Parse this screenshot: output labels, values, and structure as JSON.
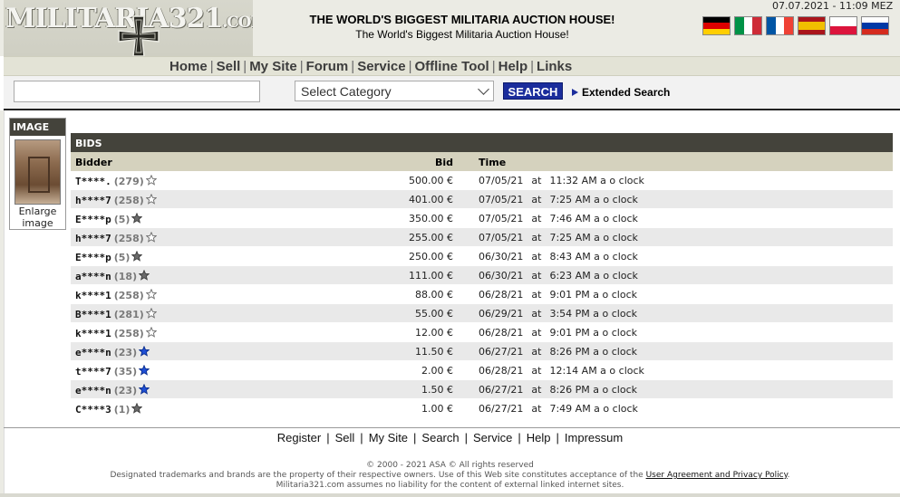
{
  "header": {
    "logo_main": "MILITARIA",
    "logo_num": "321",
    "logo_com": ".COM",
    "tagline_bold": "THE WORLD'S BIGGEST MILITARIA AUCTION HOUSE!",
    "tagline": "The World's Biggest Militaria Auction House!",
    "datetime": "07.07.2021 - 11:09 MEZ"
  },
  "flags": [
    {
      "name": "germany-flag",
      "dir": "h",
      "colors": [
        "#000000",
        "#dd0000",
        "#ffce00"
      ]
    },
    {
      "name": "italy-flag",
      "dir": "v",
      "colors": [
        "#009246",
        "#ffffff",
        "#ce2b37"
      ]
    },
    {
      "name": "france-flag",
      "dir": "v",
      "colors": [
        "#0055a4",
        "#ffffff",
        "#ef4135"
      ]
    },
    {
      "name": "spain-flag",
      "dir": "h",
      "colors": [
        "#aa151b",
        "#f1bf00",
        "#aa151b"
      ]
    },
    {
      "name": "poland-flag",
      "dir": "h",
      "colors": [
        "#ffffff",
        "#dc143c"
      ]
    },
    {
      "name": "russia-flag",
      "dir": "h",
      "colors": [
        "#ffffff",
        "#0039a6",
        "#d52b1e"
      ]
    }
  ],
  "nav": [
    "Home",
    "Sell",
    "My Site",
    "Forum",
    "Service",
    "Offline Tool",
    "Help",
    "Links"
  ],
  "search": {
    "input_value": "",
    "category_selected": "Select Category",
    "button": "SEARCH",
    "extended": "Extended Search"
  },
  "image_panel": {
    "header": "IMAGE",
    "enlarge_line1": "Enlarge",
    "enlarge_line2": "image"
  },
  "bids": {
    "header": "BIDS",
    "col_bidder": "Bidder",
    "col_bid": "Bid",
    "col_time": "Time",
    "rows": [
      {
        "bidder": "T****.",
        "score": "(279)",
        "star": "outline",
        "bid": "500.00 €",
        "date": "07/05/21",
        "at": "at",
        "time": "11:32 AM a o clock"
      },
      {
        "bidder": "h****7",
        "score": "(258)",
        "star": "outline",
        "bid": "401.00 €",
        "date": "07/05/21",
        "at": "at",
        "time": "7:25 AM a o clock"
      },
      {
        "bidder": "E****p",
        "score": "(5)",
        "star": "gray",
        "bid": "350.00 €",
        "date": "07/05/21",
        "at": "at",
        "time": "7:46 AM a o clock"
      },
      {
        "bidder": "h****7",
        "score": "(258)",
        "star": "outline",
        "bid": "255.00 €",
        "date": "07/05/21",
        "at": "at",
        "time": "7:25 AM a o clock"
      },
      {
        "bidder": "E****p",
        "score": "(5)",
        "star": "gray",
        "bid": "250.00 €",
        "date": "06/30/21",
        "at": "at",
        "time": "8:43 AM a o clock"
      },
      {
        "bidder": "a****n",
        "score": "(18)",
        "star": "gray",
        "bid": "111.00 €",
        "date": "06/30/21",
        "at": "at",
        "time": "6:23 AM a o clock"
      },
      {
        "bidder": "k****1",
        "score": "(258)",
        "star": "outline",
        "bid": "88.00 €",
        "date": "06/28/21",
        "at": "at",
        "time": "9:01 PM a o clock"
      },
      {
        "bidder": "B****1",
        "score": "(281)",
        "star": "outline",
        "bid": "55.00 €",
        "date": "06/29/21",
        "at": "at",
        "time": "3:54 PM a o clock"
      },
      {
        "bidder": "k****1",
        "score": "(258)",
        "star": "outline",
        "bid": "12.00 €",
        "date": "06/28/21",
        "at": "at",
        "time": "9:01 PM a o clock"
      },
      {
        "bidder": "e****n",
        "score": "(23)",
        "star": "blue",
        "bid": "11.50 €",
        "date": "06/27/21",
        "at": "at",
        "time": "8:26 PM a o clock"
      },
      {
        "bidder": "t****7",
        "score": "(35)",
        "star": "blue",
        "bid": "2.00 €",
        "date": "06/28/21",
        "at": "at",
        "time": "12:14 AM a o clock"
      },
      {
        "bidder": "e****n",
        "score": "(23)",
        "star": "blue",
        "bid": "1.50 €",
        "date": "06/27/21",
        "at": "at",
        "time": "8:26 PM a o clock"
      },
      {
        "bidder": "C****3",
        "score": "(1)",
        "star": "gray",
        "bid": "1.00 €",
        "date": "06/27/21",
        "at": "at",
        "time": "7:49 AM a o clock"
      }
    ]
  },
  "footer": {
    "links": [
      "Register",
      "Sell",
      "My Site",
      "Search",
      "Service",
      "Help",
      "Impressum"
    ],
    "copyright": "© 2000 - 2021 ASA © All rights reserved",
    "legal_pre": "Designated trademarks and brands are the property of their respective owners. Use of this Web site constitutes acceptance of the ",
    "legal_link": "User Agreement and Privacy Policy",
    "legal_post": ".",
    "liability": "Militaria321.com assumes no liability for the content of external linked internet sites."
  },
  "colors": {
    "dark_header": "#44433b",
    "col_header": "#d5d2be",
    "search_button": "#1b2d9c",
    "star_blue": "#1f4fd6",
    "star_gray": "#6a6a6a"
  }
}
